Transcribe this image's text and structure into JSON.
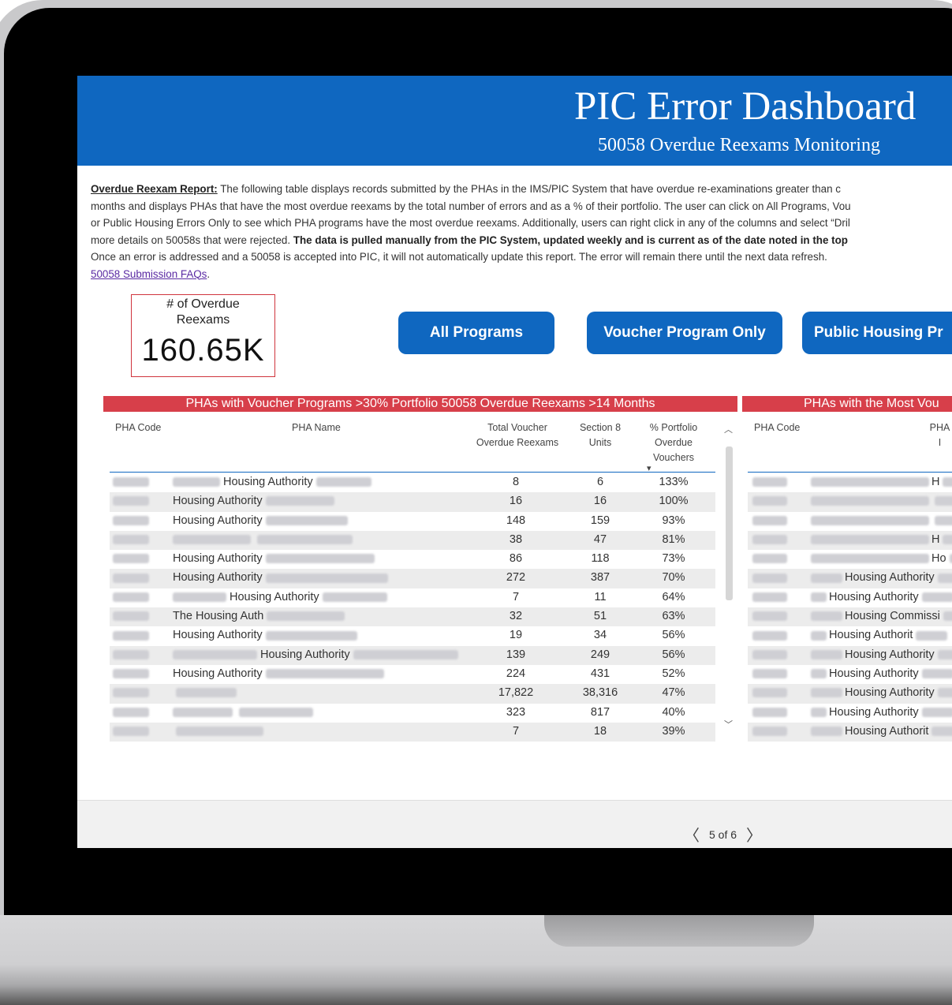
{
  "header": {
    "title": "PIC Error Dashboard",
    "subtitle": "50058 Overdue Reexams Monitoring"
  },
  "intro": {
    "lead": "Overdue Reexam Report:",
    "line1": " The following table displays records submitted by the PHAs in the IMS/PIC System that have overdue re-examinations greater than c",
    "line2": "months and displays PHAs that have the most overdue reexams by the total number of errors and as a % of their portfolio. The user can click on All Programs, Vou",
    "line3": "or Public Housing Errors Only to see which PHA programs have the most overdue reexams. Additionally, users can right click in any of the columns and select “Dril",
    "line4_plain": "more details on 50058s that were rejected. ",
    "line4_bold": "The data is pulled manually from the PIC System, updated weekly and is current as of the date noted in the top",
    "line5": "Once an error is addressed and a 50058 is accepted into PIC, it will not automatically update this report.  The error will remain there until the next data refresh.",
    "faq_link": "50058 Submission FAQs",
    "faq_suffix": "."
  },
  "kpi": {
    "label_line1": "# of Overdue",
    "label_line2": "Reexams",
    "value": "160.65K"
  },
  "buttons": {
    "all": "All Programs",
    "voucher": "Voucher Program Only",
    "public": "Public Housing Pr"
  },
  "left_table": {
    "title": "PHAs with Voucher Programs >30% Portfolio 50058 Overdue Reexams >14 Months",
    "columns": {
      "code": "PHA Code",
      "name": "PHA Name",
      "total_l1": "Total Voucher",
      "total_l2": "Overdue Reexams",
      "units_l1": "Section 8",
      "units_l2": "Units",
      "pct_l1": "% Portfolio",
      "pct_l2": "Overdue",
      "pct_l3": "Vouchers",
      "sort_icon": "▾"
    },
    "rows": [
      {
        "name": "Housing Authority",
        "total": "8",
        "units": "6",
        "pct": "133%"
      },
      {
        "name": "Housing Authority",
        "total": "16",
        "units": "16",
        "pct": "100%"
      },
      {
        "name": "Housing Authority",
        "total": "148",
        "units": "159",
        "pct": "93%"
      },
      {
        "name": "",
        "total": "38",
        "units": "47",
        "pct": "81%"
      },
      {
        "name": "Housing Authority",
        "total": "86",
        "units": "118",
        "pct": "73%"
      },
      {
        "name": "Housing Authority",
        "total": "272",
        "units": "387",
        "pct": "70%"
      },
      {
        "name": "Housing Authority",
        "total": "7",
        "units": "11",
        "pct": "64%"
      },
      {
        "name": "The Housing Auth",
        "total": "32",
        "units": "51",
        "pct": "63%"
      },
      {
        "name": "Housing Authority",
        "total": "19",
        "units": "34",
        "pct": "56%"
      },
      {
        "name": "Housing Authority",
        "total": "139",
        "units": "249",
        "pct": "56%"
      },
      {
        "name": "Housing Authority",
        "total": "224",
        "units": "431",
        "pct": "52%"
      },
      {
        "name": "",
        "total": "17,822",
        "units": "38,316",
        "pct": "47%"
      },
      {
        "name": "",
        "total": "323",
        "units": "817",
        "pct": "40%"
      },
      {
        "name": "",
        "total": "7",
        "units": "18",
        "pct": "39%"
      }
    ]
  },
  "right_table": {
    "title": "PHAs with the Most Vou",
    "columns": {
      "code": "PHA Code",
      "name": "PHA I"
    },
    "rows": [
      {
        "name": "H"
      },
      {
        "name": ""
      },
      {
        "name": ""
      },
      {
        "name": "H"
      },
      {
        "name": "Ho"
      },
      {
        "name": "Housing Authority"
      },
      {
        "name": "Housing Authority"
      },
      {
        "name": "Housing Commissi"
      },
      {
        "name": "Housing Authorit"
      },
      {
        "name": "Housing Authority"
      },
      {
        "name": "Housing Authority"
      },
      {
        "name": "Housing Authority"
      },
      {
        "name": "Housing Authority"
      },
      {
        "name": "Housing Authorit"
      }
    ]
  },
  "pager": {
    "prev": "〈",
    "label": "5 of 6",
    "next": "〉"
  },
  "colors": {
    "header_blue": "#0f67c0",
    "title_red": "#d73f4a"
  }
}
